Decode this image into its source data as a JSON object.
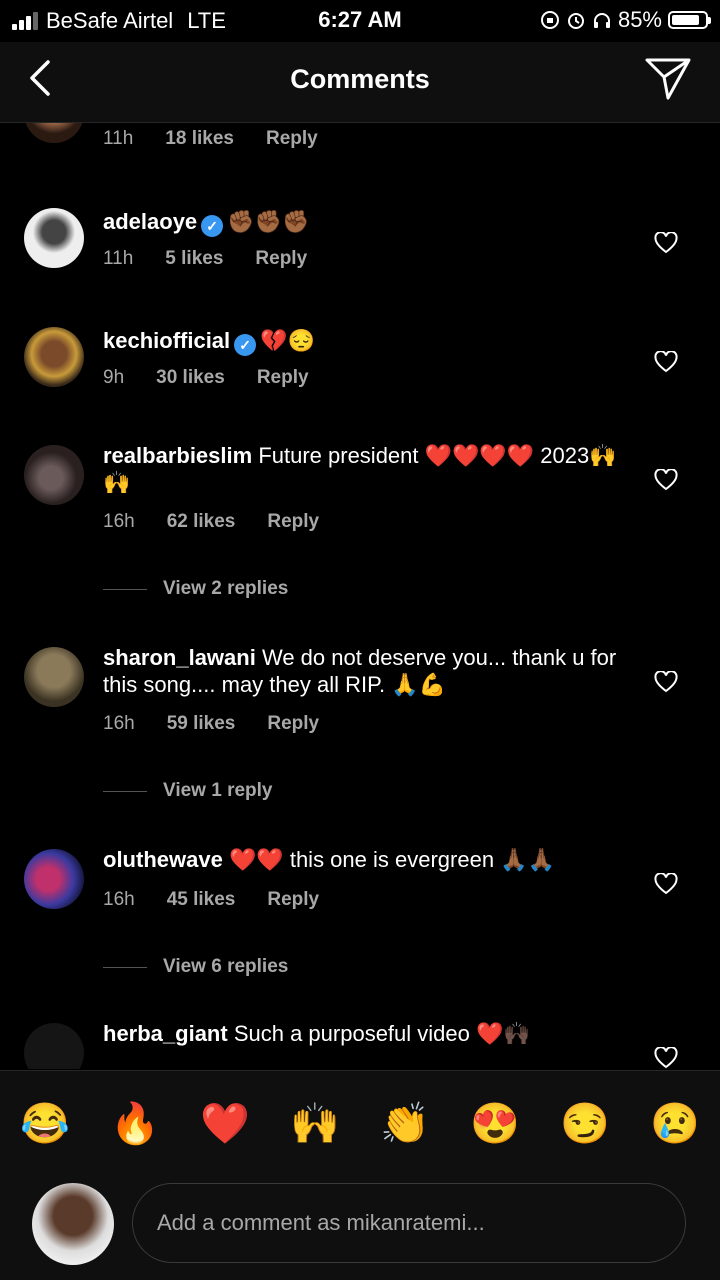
{
  "status_bar": {
    "carrier": "BeSafe Airtel",
    "network": "LTE",
    "time": "6:27 AM",
    "battery": "85%",
    "battery_fraction": 0.85
  },
  "header": {
    "title": "Comments"
  },
  "top_partial": {
    "time": "11h",
    "likes": "18 likes",
    "reply": "Reply"
  },
  "comments": [
    {
      "username": "adelaoye",
      "verified": true,
      "text": "✊🏾✊🏾✊🏾",
      "time": "11h",
      "likes": "5 likes",
      "reply": "Reply"
    },
    {
      "username": "kechiofficial",
      "verified": true,
      "text": "💔😔",
      "time": "9h",
      "likes": "30 likes",
      "reply": "Reply"
    },
    {
      "username": "realbarbieslim",
      "verified": false,
      "text": "Future president ❤️❤️❤️❤️ 2023🙌🙌",
      "time": "16h",
      "likes": "62 likes",
      "reply": "Reply",
      "view_replies": "View 2 replies"
    },
    {
      "username": "sharon_lawani",
      "verified": false,
      "text": "We do not deserve you... thank u for this song.... may they all RIP. 🙏💪",
      "time": "16h",
      "likes": "59 likes",
      "reply": "Reply",
      "view_replies": "View 1 reply"
    },
    {
      "username": "oluthewave",
      "verified": false,
      "text": "❤️❤️ this one is evergreen 🙏🏾🙏🏾",
      "time": "16h",
      "likes": "45 likes",
      "reply": "Reply",
      "view_replies": "View 6 replies"
    },
    {
      "username": "herba_giant",
      "verified": false,
      "text": "Such a purposeful video ❤️🙌🏿"
    }
  ],
  "emoji_bar": [
    "😂",
    "🔥",
    "❤️",
    "🙌",
    "👏",
    "😍",
    "😏",
    "😢"
  ],
  "input": {
    "placeholder": "Add a comment as mikanratemi..."
  },
  "colors": {
    "background": "#000000",
    "secondary_text": "#a8a8a8",
    "verified": "#3897f0",
    "like_red": "#ed4956"
  }
}
